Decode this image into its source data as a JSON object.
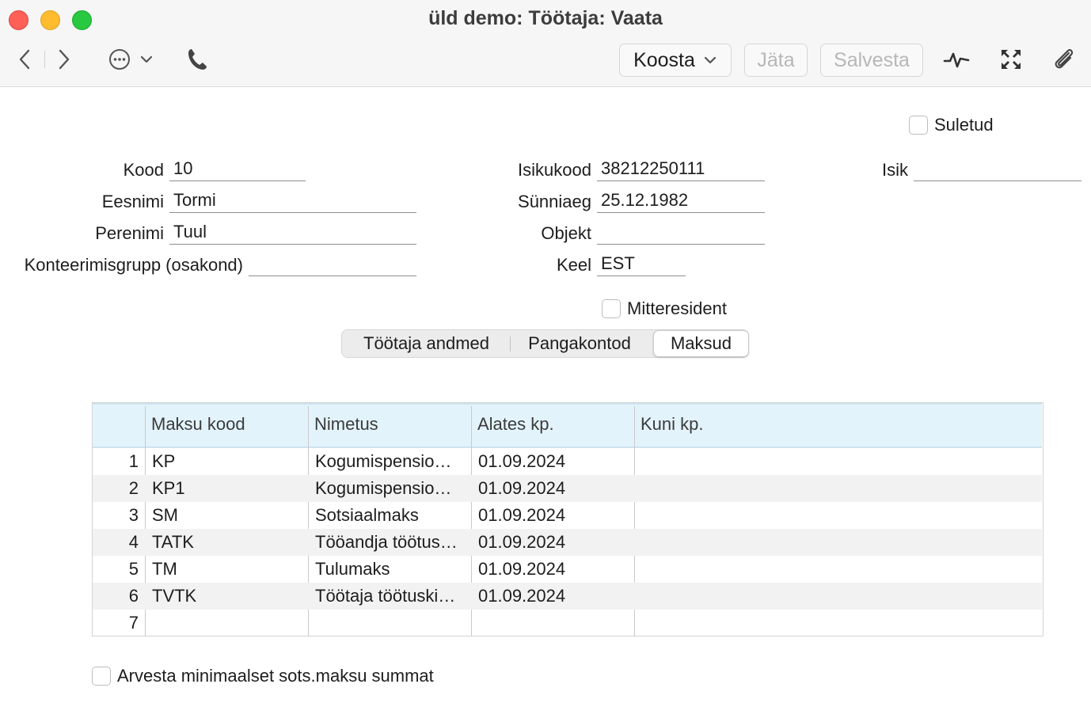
{
  "window": {
    "title": "üld demo: Töötaja: Vaata"
  },
  "toolbar": {
    "koosta_label": "Koosta",
    "jata_label": "Jäta",
    "salvesta_label": "Salvesta"
  },
  "form": {
    "suletud_label": "Suletud",
    "kood_label": "Kood",
    "kood_value": "10",
    "eesnimi_label": "Eesnimi",
    "eesnimi_value": "Tormi",
    "perenimi_label": "Perenimi",
    "perenimi_value": "Tuul",
    "konteerimisgrupp_label": "Konteerimisgrupp (osakond)",
    "konteerimisgrupp_value": "",
    "isikukood_label": "Isikukood",
    "isikukood_value": "38212250111",
    "sunniaeg_label": "Sünniaeg",
    "sunniaeg_value": "25.12.1982",
    "objekt_label": "Objekt",
    "objekt_value": "",
    "keel_label": "Keel",
    "keel_value": "EST",
    "isik_label": "Isik",
    "isik_value": "",
    "mitteresident_label": "Mitteresident"
  },
  "tabs": [
    {
      "label": "Töötaja andmed",
      "active": false
    },
    {
      "label": "Pangakontod",
      "active": false
    },
    {
      "label": "Maksud",
      "active": true
    }
  ],
  "grid": {
    "columns": [
      "",
      "Maksu kood",
      "Nimetus",
      "Alates kp.",
      "Kuni kp."
    ],
    "rows": [
      {
        "n": "1",
        "kood": "KP",
        "nimetus": "Kogumispensio…",
        "alates": "01.09.2024",
        "kuni": ""
      },
      {
        "n": "2",
        "kood": "KP1",
        "nimetus": "Kogumispensio…",
        "alates": "01.09.2024",
        "kuni": ""
      },
      {
        "n": "3",
        "kood": "SM",
        "nimetus": "Sotsiaalmaks",
        "alates": "01.09.2024",
        "kuni": ""
      },
      {
        "n": "4",
        "kood": "TATK",
        "nimetus": "Tööandja töötus…",
        "alates": "01.09.2024",
        "kuni": ""
      },
      {
        "n": "5",
        "kood": "TM",
        "nimetus": "Tulumaks",
        "alates": "01.09.2024",
        "kuni": ""
      },
      {
        "n": "6",
        "kood": "TVTK",
        "nimetus": "Töötaja töötuski…",
        "alates": "01.09.2024",
        "kuni": ""
      },
      {
        "n": "7",
        "kood": "",
        "nimetus": "",
        "alates": "",
        "kuni": ""
      }
    ]
  },
  "footer": {
    "arvesta_label": "Arvesta minimaalset sots.maksu summat"
  },
  "colors": {
    "grid_header": "#e3f3fb",
    "close": "#fe5f57",
    "minimize": "#febc2e",
    "maximize": "#28c840"
  }
}
